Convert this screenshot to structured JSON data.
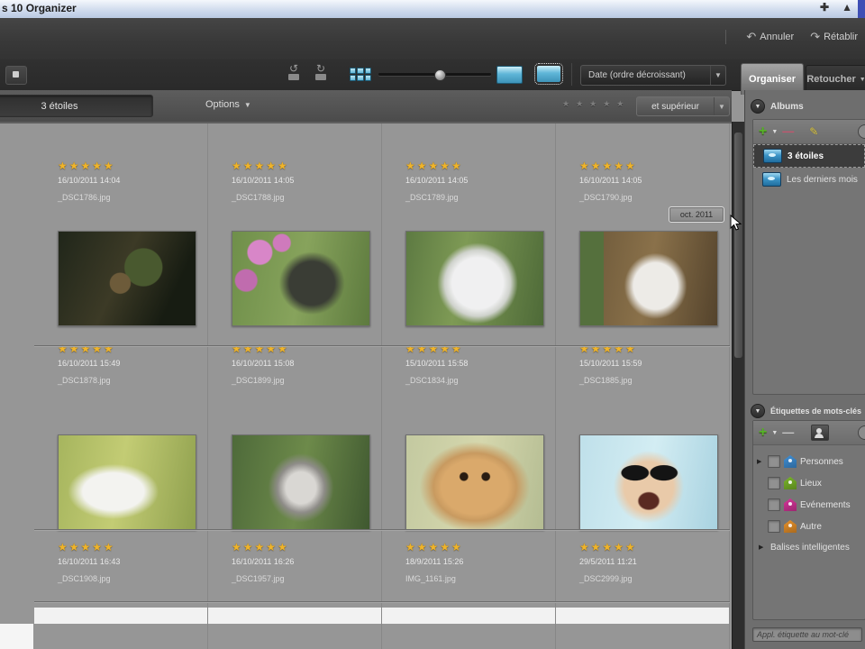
{
  "window": {
    "title": "s 10 Organizer",
    "titlebar_icons": [
      "move-icon",
      "eject-icon"
    ]
  },
  "menubar": {
    "undo_label": "Annuler",
    "redo_label": "Rétablir"
  },
  "toolbar": {
    "rotate_left": "rotate-left",
    "rotate_right": "rotate-right",
    "sort_dropdown_value": "Date (ordre décroissant)",
    "zoom_slider_value": "small-thumbnails"
  },
  "tabs": {
    "organize": "Organiser",
    "fix": "Retoucher"
  },
  "options_bar": {
    "album_button_label": "3 étoiles",
    "options_label": "Options",
    "rating_dots": "★★★★★",
    "rating_filter_label": "et supérieur"
  },
  "date_tooltip": "oct. 2011",
  "albums_panel": {
    "title": "Albums",
    "items": [
      {
        "label": "3 étoiles",
        "selected": true
      },
      {
        "label": "Les derniers mois",
        "selected": false
      }
    ]
  },
  "tags_panel": {
    "title": "Étiquettes de mots-clés",
    "tags": [
      {
        "label": "Personnes",
        "color": "#3f8fd6",
        "expandable": true
      },
      {
        "label": "Lieux",
        "color": "#7ab62a",
        "expandable": false
      },
      {
        "label": "Evénements",
        "color": "#d6359a",
        "expandable": false
      },
      {
        "label": "Autre",
        "color": "#e8912a",
        "expandable": false
      }
    ],
    "smart_tags_label": "Balises intelligentes",
    "input_placeholder": "Appl. étiquette au mot-clé"
  },
  "grid": {
    "stars": "★★★★★",
    "rating": 5,
    "rows": [
      {
        "type": "caption-only",
        "cells": [
          {
            "date": "16/10/2011 14:04",
            "file": "_DSC1786.jpg"
          },
          {
            "date": "16/10/2011 14:05",
            "file": "_DSC1788.jpg"
          },
          {
            "date": "16/10/2011 14:05",
            "file": "_DSC1789.jpg"
          },
          {
            "date": "16/10/2011 14:05",
            "file": "_DSC1790.jpg"
          }
        ]
      },
      {
        "type": "full",
        "cells": [
          {
            "photo": "r2c1",
            "alt": "dog-in-dark-forest",
            "date": "16/10/2011 15:49",
            "file": "_DSC1878.jpg"
          },
          {
            "photo": "r2c2",
            "alt": "dog-with-pink-flowers",
            "date": "16/10/2011 15:08",
            "file": "_DSC1899.jpg"
          },
          {
            "photo": "r2c3",
            "alt": "white-cat-green-background",
            "date": "15/10/2011 15:58",
            "file": "_DSC1834.jpg"
          },
          {
            "photo": "r2c4",
            "alt": "white-cat-in-wooden-box",
            "date": "15/10/2011 15:59",
            "file": "_DSC1885.jpg"
          }
        ]
      },
      {
        "type": "full",
        "cells": [
          {
            "photo": "r3c1",
            "alt": "white-cat-on-grass",
            "date": "16/10/2011 16:43",
            "file": "_DSC1908.jpg"
          },
          {
            "photo": "r3c2",
            "alt": "grey-cat-in-plants",
            "date": "16/10/2011 16:26",
            "file": "_DSC1957.jpg"
          },
          {
            "photo": "r3c3",
            "alt": "orange-kitten-closeup",
            "date": "18/9/2011 15:26",
            "file": "IMG_1161.jpg"
          },
          {
            "photo": "r3c4",
            "alt": "boy-with-goggles",
            "date": "29/5/2011 11:21",
            "file": "_DSC2999.jpg"
          }
        ]
      }
    ]
  }
}
